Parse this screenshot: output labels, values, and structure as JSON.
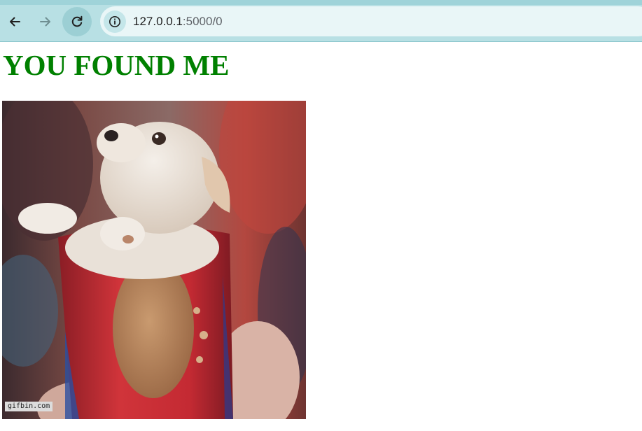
{
  "browser": {
    "back_icon": "arrow-left-icon",
    "forward_icon": "arrow-right-icon",
    "reload_icon": "reload-icon",
    "site_info_icon": "info-icon",
    "url_host": "127.0.0.1",
    "url_path": ":5000/0",
    "colors": {
      "toolbar": "#b8e0e4",
      "omnibox": "#e9f6f7"
    }
  },
  "page": {
    "heading": "YOU FOUND ME",
    "heading_color": "#008000",
    "gif": {
      "watermark": "gifbin.com"
    }
  }
}
